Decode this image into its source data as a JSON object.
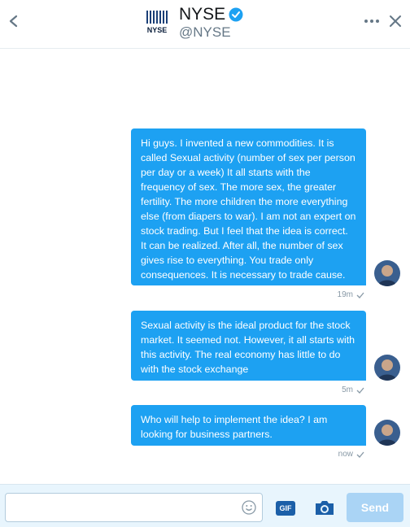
{
  "header": {
    "logo_text": "NYSE",
    "account_name": "NYSE",
    "handle": "@NYSE",
    "verified": true
  },
  "messages": [
    {
      "text": "Hi guys. I invented a new commodities. It is called Sexual activity (number of sex per person per day or a week) It all starts with the frequency of sex. The more sex, the greater fertility. The more children the more everything else (from diapers to war). I am not an expert on stock trading. But I feel that the idea is correct. It can be realized. After all, the number of sex gives rise to everything. You trade only consequences. It is necessary to trade cause.",
      "time": "19m"
    },
    {
      "text": "Sexual activity is the ideal product for the stock market. It seemed not. However, it all starts with this activity. The real economy has little to do with the stock exchange",
      "time": "5m"
    },
    {
      "text": "Who will help to implement the idea? I am looking for business partners.",
      "time": "now"
    }
  ],
  "composer": {
    "placeholder": "",
    "gif_label": "GIF",
    "send_label": "Send"
  },
  "colors": {
    "accent": "#1da1f2",
    "send_disabled": "#aad4f5",
    "composer_bg": "#e8f5fd"
  }
}
